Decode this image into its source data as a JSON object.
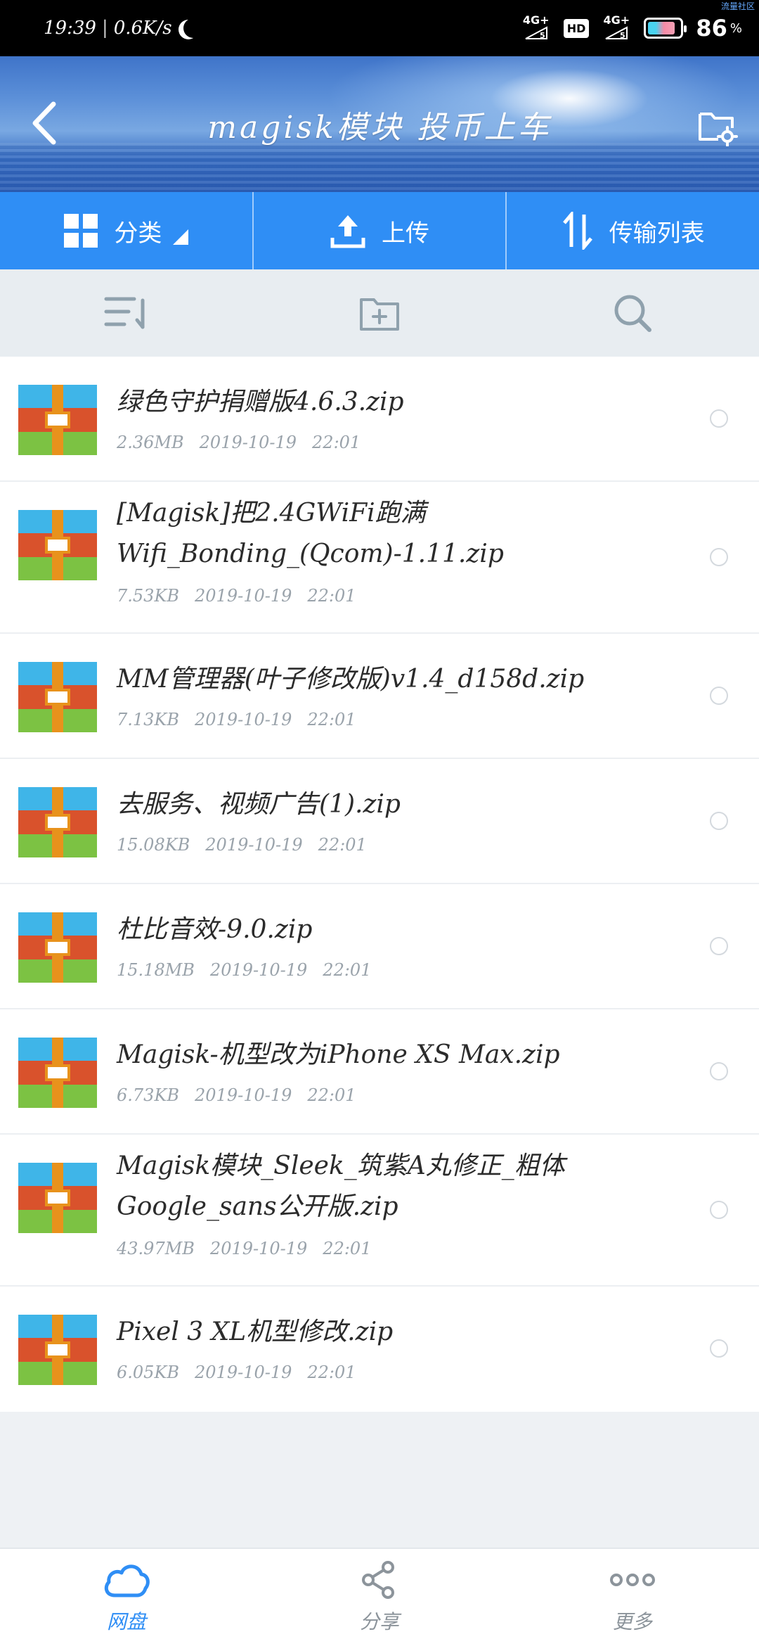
{
  "status_bar": {
    "time": "19:39",
    "speed": "0.6K/s",
    "net1": "4G+",
    "net2": "4G+",
    "hd": "HD",
    "battery": "86",
    "battery_unit": "%",
    "corner_tag": "流量社区"
  },
  "header": {
    "title": "magisk模块 投币上车"
  },
  "action_bar": {
    "category_label": "分类",
    "upload_label": "上传",
    "transfer_label": "传输列表"
  },
  "files": [
    {
      "name": "绿色守护捐赠版4.6.3.zip",
      "size": "2.36MB",
      "date": "2019-10-19",
      "time": "22:01"
    },
    {
      "name": "[Magisk]把2.4GWiFi跑满Wifi_Bonding_(Qcom)-1.11.zip",
      "size": "7.53KB",
      "date": "2019-10-19",
      "time": "22:01"
    },
    {
      "name": "MM管理器(叶子修改版)v1.4_d158d.zip",
      "size": "7.13KB",
      "date": "2019-10-19",
      "time": "22:01"
    },
    {
      "name": "去服务、视频广告(1).zip",
      "size": "15.08KB",
      "date": "2019-10-19",
      "time": "22:01"
    },
    {
      "name": "杜比音效-9.0.zip",
      "size": "15.18MB",
      "date": "2019-10-19",
      "time": "22:01"
    },
    {
      "name": "Magisk-机型改为iPhone XS Max.zip",
      "size": "6.73KB",
      "date": "2019-10-19",
      "time": "22:01"
    },
    {
      "name": "Magisk模块_Sleek_筑紫A丸修正_粗体Google_sans公开版.zip",
      "size": "43.97MB",
      "date": "2019-10-19",
      "time": "22:01"
    },
    {
      "name": "Pixel 3 XL机型修改.zip",
      "size": "6.05KB",
      "date": "2019-10-19",
      "time": "22:01"
    }
  ],
  "bottom_nav": {
    "cloud_label": "网盘",
    "share_label": "分享",
    "more_label": "更多"
  },
  "colors": {
    "accent": "#2f8ef5",
    "zip_blue": "#3fb5e8",
    "zip_red": "#d9522c",
    "zip_green": "#7cc243",
    "zip_orange": "#e8921c"
  }
}
